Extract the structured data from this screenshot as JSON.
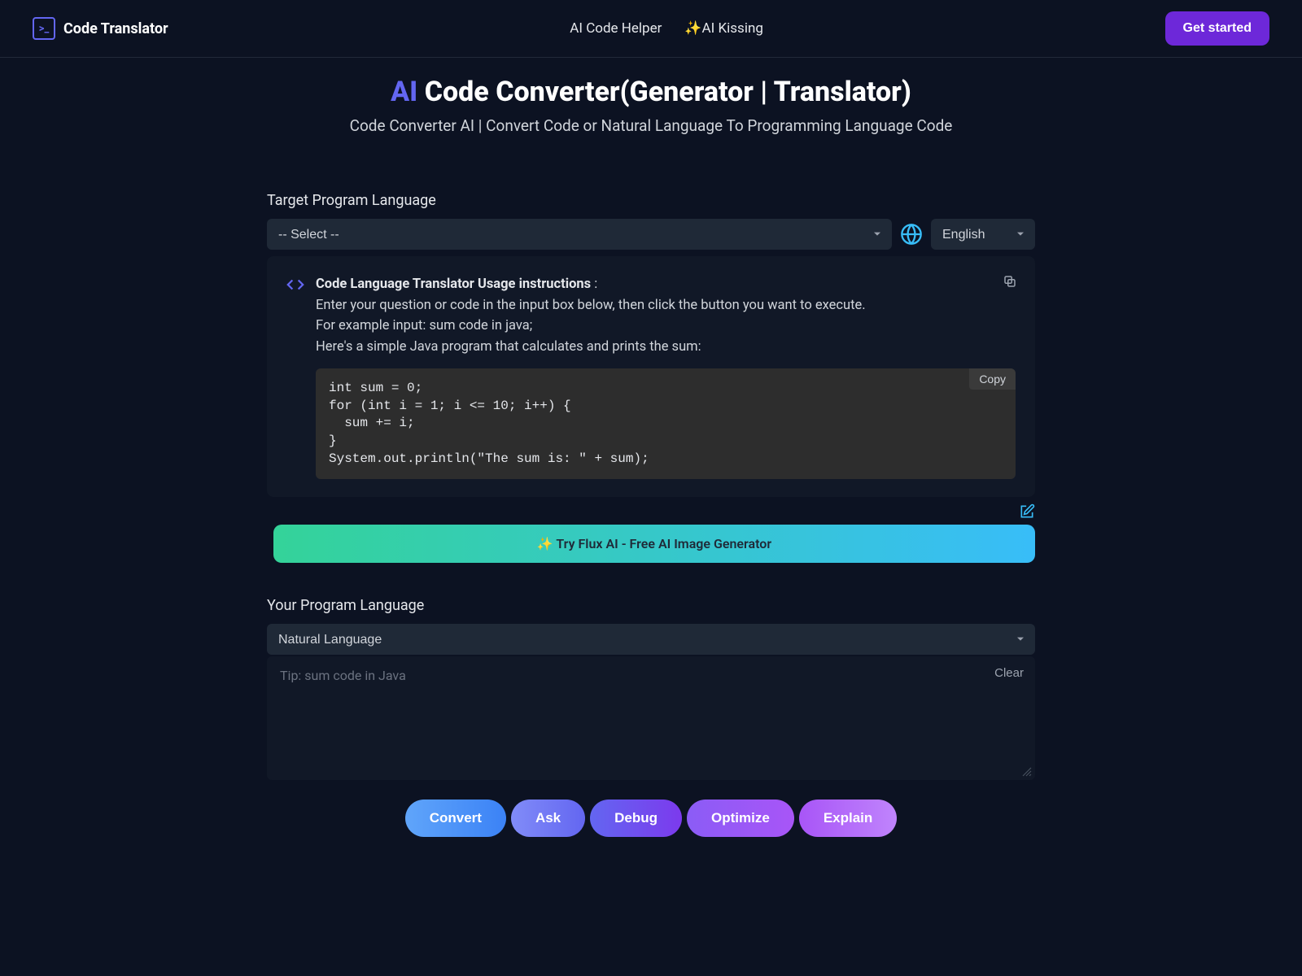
{
  "header": {
    "logo_glyph": ">_",
    "logo_text": "Code Translator",
    "nav": {
      "code_helper": "AI Code Helper",
      "ai_kissing": "✨AI Kissing"
    },
    "get_started": "Get started"
  },
  "hero": {
    "ai": "AI",
    "rest": " Code Converter(Generator | Translator)",
    "subtitle": "Code Converter AI | Convert Code or Natural Language To Programming Language Code"
  },
  "target": {
    "label": "Target Program Language",
    "select_placeholder": "-- Select --",
    "lang_select": "English"
  },
  "instructions": {
    "title": "Code Language Translator Usage instructions",
    "colon": " :",
    "line1": "Enter your question or code in the input box below, then click the button you want to execute.",
    "line2": "For example input: sum code in java;",
    "line3": "Here's a simple Java program that calculates and prints the sum:",
    "copy_label": "Copy",
    "code": "int sum = 0;\nfor (int i = 1; i <= 10; i++) {\n  sum += i;\n}\nSystem.out.println(\"The sum is: \" + sum);"
  },
  "promo": {
    "text": "✨ Try Flux AI - Free AI Image Generator"
  },
  "your": {
    "label": "Your Program Language",
    "select_value": "Natural Language",
    "placeholder": "Tip: sum code in Java",
    "clear": "Clear"
  },
  "buttons": {
    "convert": "Convert",
    "ask": "Ask",
    "debug": "Debug",
    "optimize": "Optimize",
    "explain": "Explain"
  }
}
